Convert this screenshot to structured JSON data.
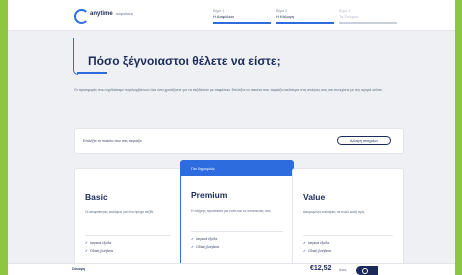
{
  "brand": {
    "name": "anytime",
    "tagline": "ασφαλίσεις",
    "accent": "#2d6cdf"
  },
  "steps": [
    {
      "label": "Βήμα 1",
      "name": "Η Ασφάλεια"
    },
    {
      "label": "Βήμα 2",
      "name": "Η Κάλυψη"
    },
    {
      "label": "Βήμα 3",
      "name": "Τα Στοιχεία"
    }
  ],
  "title": "Πόσο ξέγνοιαστοι θέλετε να είστε;",
  "intro": "Οι προσφορές που σχεδιάσαμε περιλαμβάνουν όλα όσα χρειάζεστε για να ταξιδεύετε με ασφάλεια. Επιλέξτε το πακέτο που ταιριάζει καλύτερα στις ανάγκες σας και συνεχίστε με την αγορά online.",
  "notice": {
    "text": "Επιλέξτε το πακέτο που σας ταιριάζει",
    "button": "Αλλαγή στοιχείων"
  },
  "plans": [
    {
      "name": "Basic",
      "description": "Οι απαραίτητες καλύψεις για ένα ήσυχο ταξίδι.",
      "features": [
        "Ιατρικά έξοδα",
        "Οδική βοήθεια"
      ]
    },
    {
      "badge": "Πιο δημοφιλές",
      "name": "Premium",
      "description": "Η πλήρης προστασία για εσάς και τις αποσκευές σας.",
      "features": [
        "Ιατρικά έξοδα",
        "Οδική βοήθεια"
      ]
    },
    {
      "name": "Value",
      "description": "Διευρυμένες καλύψεις σε πολύ καλή τιμή.",
      "features": [
        "Ιατρικά έξοδα",
        "Οδική βοήθεια"
      ]
    }
  ],
  "footer": {
    "label": "Σύνοψη",
    "price": "€12,52",
    "unit": "/έτος"
  }
}
